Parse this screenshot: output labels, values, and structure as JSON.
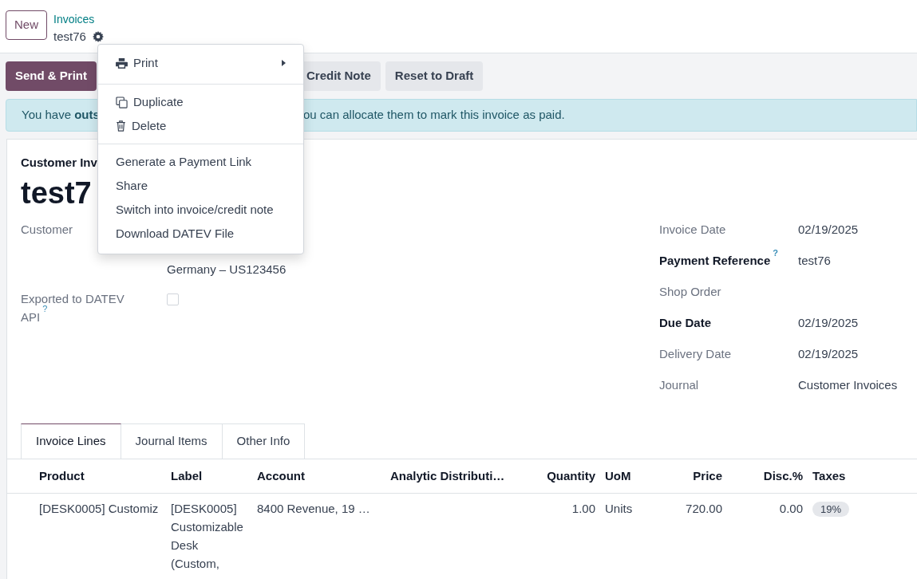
{
  "control_panel": {
    "new_button": "New",
    "breadcrumb": "Invoices",
    "record": "test76"
  },
  "menu": {
    "sections": [
      [
        {
          "label": "Print",
          "kind": "print",
          "submenu": true
        }
      ],
      [
        {
          "label": "Duplicate",
          "kind": "duplicate",
          "submenu": false
        },
        {
          "label": "Delete",
          "kind": "delete",
          "submenu": false
        }
      ],
      [
        {
          "label": "Generate a Payment Link",
          "kind": "plain",
          "submenu": false
        },
        {
          "label": "Share",
          "kind": "plain",
          "submenu": false
        },
        {
          "label": "Switch into invoice/credit note",
          "kind": "plain",
          "submenu": false
        },
        {
          "label": "Download DATEV File",
          "kind": "plain",
          "submenu": false
        }
      ]
    ]
  },
  "actions": [
    {
      "label": "Send & Print",
      "kind": "primary"
    },
    {
      "label": "Credit Note",
      "kind": "secondary"
    },
    {
      "label": "Reset to Draft",
      "kind": "secondary"
    }
  ],
  "alert": {
    "parts": [
      "You have **outs**",
      "ou can allocate them to mark this invoice as paid."
    ]
  },
  "sheet": {
    "subtitle": "Customer Inv",
    "title": "test7",
    "left_fields": [
      {
        "label": "Customer",
        "kind": "text",
        "value": "Germany – US123456"
      },
      {
        "label": "Exported to DATEV API",
        "kind": "checkbox",
        "checked": false,
        "help_mark": "?"
      }
    ],
    "right_fields": [
      {
        "label": "Invoice Date",
        "value": "02/19/2025",
        "required": false
      },
      {
        "label": "Payment Reference",
        "value": "test76",
        "required": true,
        "help_mark": "?"
      },
      {
        "label": "Shop Order",
        "required": false
      },
      {
        "label": "Due Date",
        "value": "02/19/2025",
        "required": true
      },
      {
        "label": "Delivery Date",
        "value": "02/19/2025",
        "required": false
      },
      {
        "label": "Journal",
        "value": "Customer Invoices",
        "required": false
      }
    ]
  },
  "tabs": [
    {
      "label": "Invoice Lines",
      "selected": true
    },
    {
      "label": "Journal Items",
      "selected": false
    },
    {
      "label": "Other Info",
      "selected": false
    }
  ],
  "table": {
    "columns": [
      "Product",
      "Label",
      "Account",
      "Analytic Distributi…",
      "Quantity",
      "UoM",
      "Price",
      "Disc.%",
      "Taxes"
    ],
    "rows": [
      {
        "product": "[DESK0005] Customiz",
        "label": "[DESK0005] Customizable Desk (Custom,",
        "account": "8400 Revenue, 19 …",
        "quantity": "1.00",
        "uom": "Units",
        "price": "720.00",
        "discount": "0.00",
        "taxes": [
          "19%"
        ]
      }
    ]
  }
}
